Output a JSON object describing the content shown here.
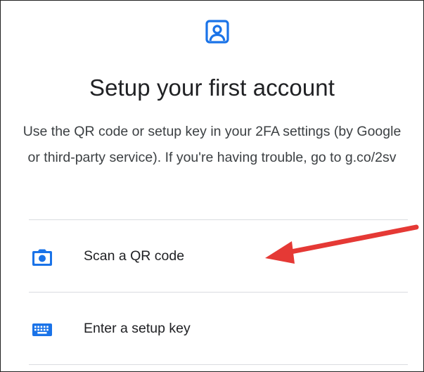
{
  "setup": {
    "title": "Setup your first account",
    "description": "Use the QR code or setup key in your 2FA settings (by Google or third-party service). If you're having trouble, go to g.co/2sv",
    "options": [
      {
        "label": "Scan a QR code",
        "icon": "camera-icon"
      },
      {
        "label": "Enter a setup key",
        "icon": "keyboard-icon"
      }
    ]
  },
  "colors": {
    "accent": "#1a73e8",
    "annotation_arrow": "#e53935",
    "divider": "#dadce0"
  },
  "icons": {
    "header": "account-box-icon"
  }
}
